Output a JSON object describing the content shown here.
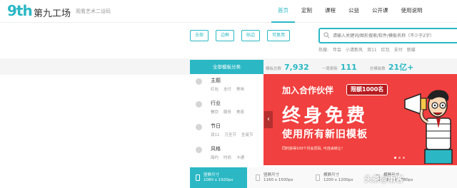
{
  "header": {
    "logo": "9th",
    "logo_cn": "第九工场",
    "tagline": "观看艺术二设码",
    "nav": [
      "首页",
      "定制",
      "课程",
      "公益",
      "公开课",
      "使用说明"
    ]
  },
  "filters": [
    "全部",
    "边框",
    "贴边",
    "可复用"
  ],
  "search": {
    "placeholder": "请输入关键词/图形搜索/软件/模板名称（不少于2字）"
  },
  "hot_tags": [
    "热搜:",
    "年会",
    "小清新风",
    "双11",
    "红包",
    "支付",
    "新媒"
  ],
  "category_header": "全部模板分类",
  "categories": [
    {
      "title": "主题",
      "subs": [
        "红包",
        "支付",
        "美味"
      ]
    },
    {
      "title": "行业",
      "subs": [
        "餐饮",
        "服务",
        "美容"
      ]
    },
    {
      "title": "节日",
      "subs": [
        "双11",
        "万圣节",
        "圣诞节"
      ]
    },
    {
      "title": "风格",
      "subs": [
        "简约",
        "时尚",
        "卡通"
      ]
    }
  ],
  "stats": [
    {
      "label": "模板总数",
      "value": "7,932"
    },
    {
      "label": "一周更新",
      "value": "111"
    },
    {
      "label": "总模板数",
      "value": "21亿+"
    }
  ],
  "banner": {
    "join": "加入合作伙伴",
    "limit": "限额1000名",
    "big": "终身免费",
    "mid": "使用所有新旧模板",
    "small": "同时获得100个月会员码, 可自由转让！",
    "arrow": "‹"
  },
  "sizes": [
    {
      "l1": "竖屏尺寸",
      "l2": "1080 x 1920px"
    },
    {
      "l1": "竖屏尺寸",
      "l2": "1160 x 1500px"
    },
    {
      "l1": "横屏尺寸",
      "l2": "1200 x 1200px"
    },
    {
      "l1": "横屏尺寸",
      "l2": "1920 x 1080px"
    }
  ],
  "watermark": "头条@雨客"
}
